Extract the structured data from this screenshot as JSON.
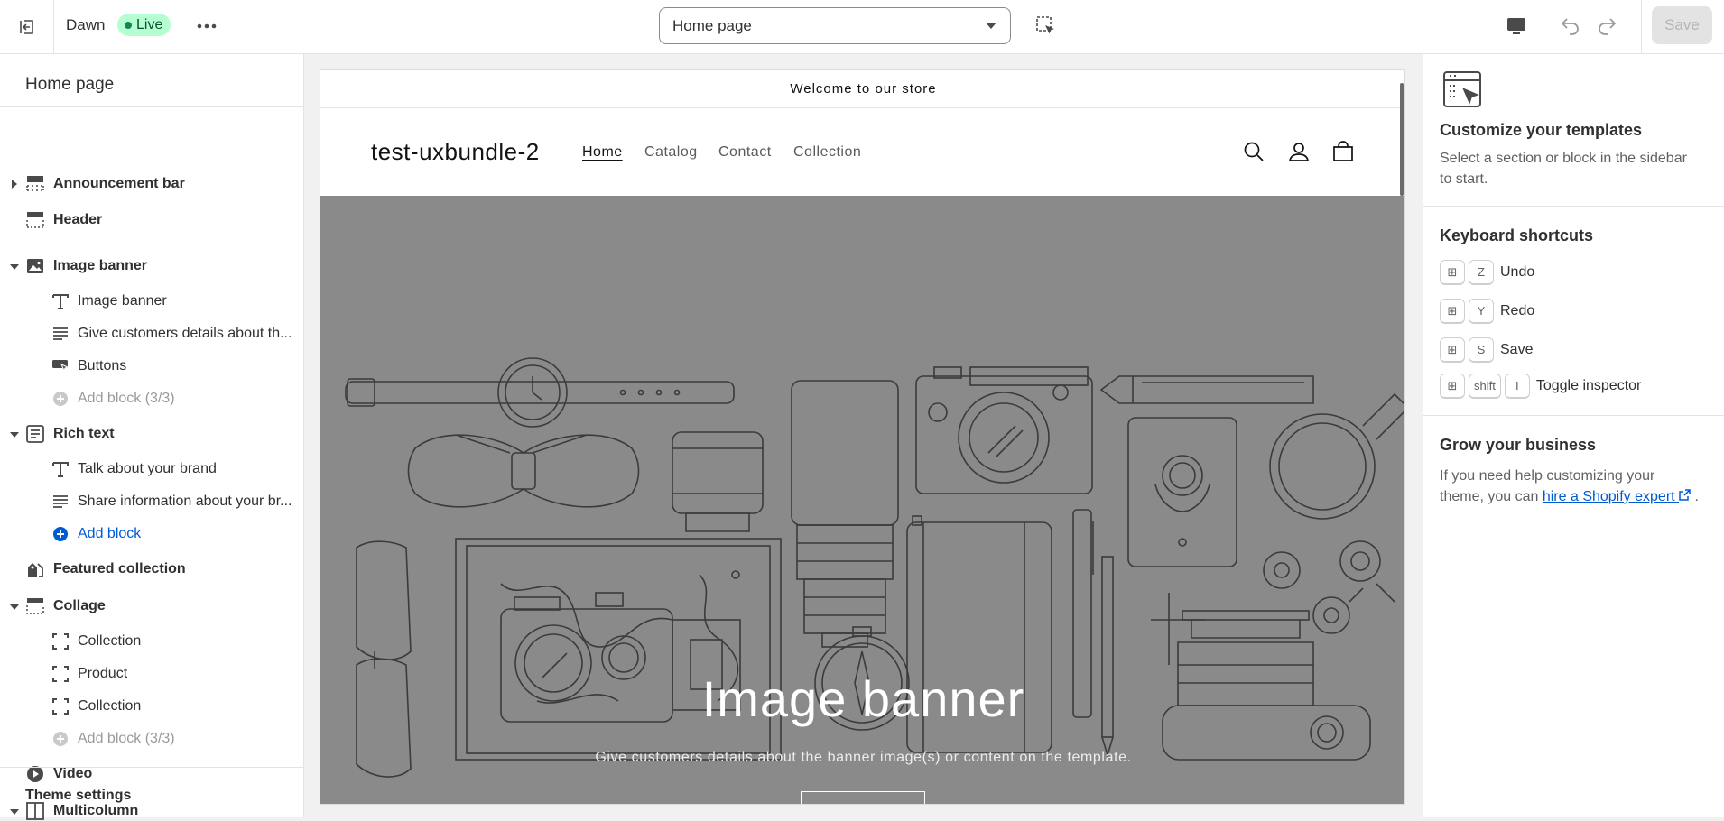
{
  "topbar": {
    "theme_name": "Dawn",
    "status_badge": "Live",
    "template_select": "Home page",
    "save_label": "Save"
  },
  "sidebar": {
    "title": "Home page",
    "items": [
      {
        "label": "Announcement bar"
      },
      {
        "label": "Header"
      },
      {
        "label": "Image banner"
      },
      {
        "label": "Image banner"
      },
      {
        "label": "Give customers details about th..."
      },
      {
        "label": "Buttons"
      },
      {
        "label": "Add block (3/3)"
      },
      {
        "label": "Rich text"
      },
      {
        "label": "Talk about your brand"
      },
      {
        "label": "Share information about your br..."
      },
      {
        "label": "Add block"
      },
      {
        "label": "Featured collection"
      },
      {
        "label": "Collage"
      },
      {
        "label": "Collection"
      },
      {
        "label": "Product"
      },
      {
        "label": "Collection"
      },
      {
        "label": "Add block (3/3)"
      },
      {
        "label": "Video"
      },
      {
        "label": "Multicolumn"
      }
    ],
    "theme_settings": "Theme settings"
  },
  "preview": {
    "announcement": "Welcome to our store",
    "store_name": "test-uxbundle-2",
    "nav": [
      "Home",
      "Catalog",
      "Contact",
      "Collection"
    ],
    "banner_title": "Image banner",
    "banner_subtitle": "Give customers details about the banner image(s) or content on the template."
  },
  "right_panel": {
    "customize_title": "Customize your templates",
    "customize_text": "Select a section or block in the sidebar to start.",
    "shortcuts_title": "Keyboard shortcuts",
    "shortcuts": [
      {
        "keys": [
          "⊞",
          "Z"
        ],
        "label": "Undo"
      },
      {
        "keys": [
          "⊞",
          "Y"
        ],
        "label": "Redo"
      },
      {
        "keys": [
          "⊞",
          "S"
        ],
        "label": "Save"
      },
      {
        "keys": [
          "⊞",
          "shift",
          "I"
        ],
        "label": "Toggle inspector"
      }
    ],
    "grow_title": "Grow your business",
    "grow_text_1": "If you need help customizing your theme, you can ",
    "grow_link": "hire a Shopify expert",
    "grow_text_2": " ."
  },
  "colors": {
    "live_badge_bg": "#b4fed2",
    "link": "#005bd3",
    "banner_bg": "#8a8a8a"
  }
}
